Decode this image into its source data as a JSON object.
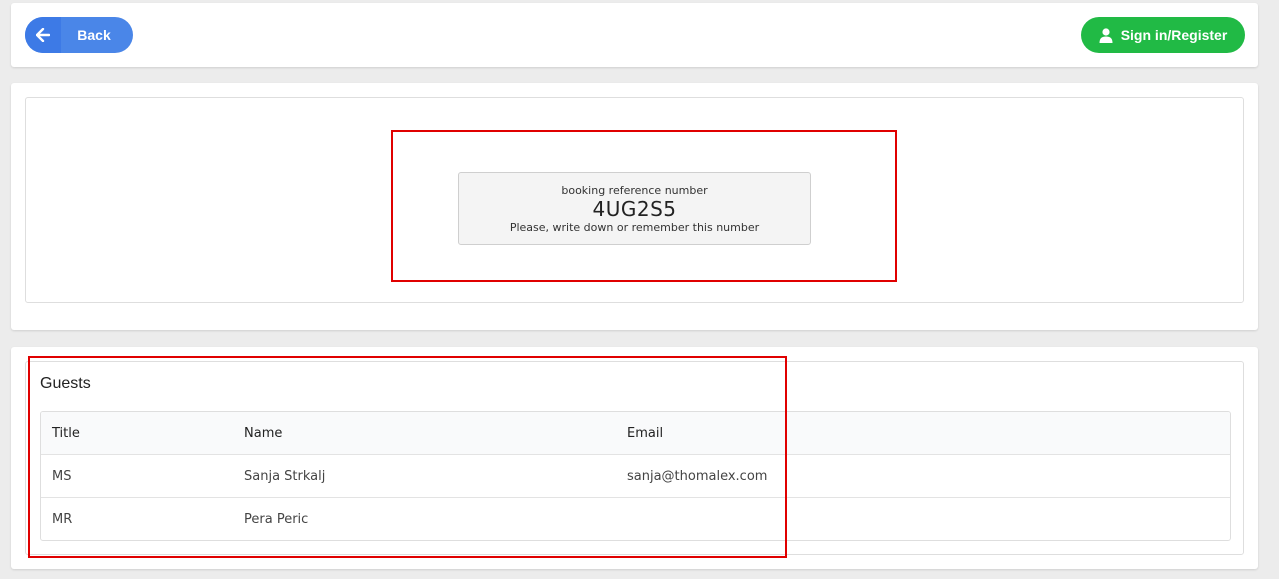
{
  "header": {
    "back_label": "Back",
    "sign_label": "Sign in/Register"
  },
  "reference": {
    "caption": "booking reference number",
    "number": "4UG2S5",
    "note": "Please, write down or remember this number"
  },
  "guests": {
    "title": "Guests",
    "columns": [
      "Title",
      "Name",
      "Email"
    ],
    "rows": [
      [
        "MS",
        "Sanja Strkalj",
        "sanja@thomalex.com"
      ],
      [
        "MR",
        "Pera Peric",
        ""
      ]
    ]
  },
  "colors": {
    "back_button": "#4a86e8",
    "sign_button": "#21ba45",
    "highlight": "#e00000"
  },
  "icons": {
    "back": "arrow-left-icon",
    "sign": "user-icon"
  }
}
